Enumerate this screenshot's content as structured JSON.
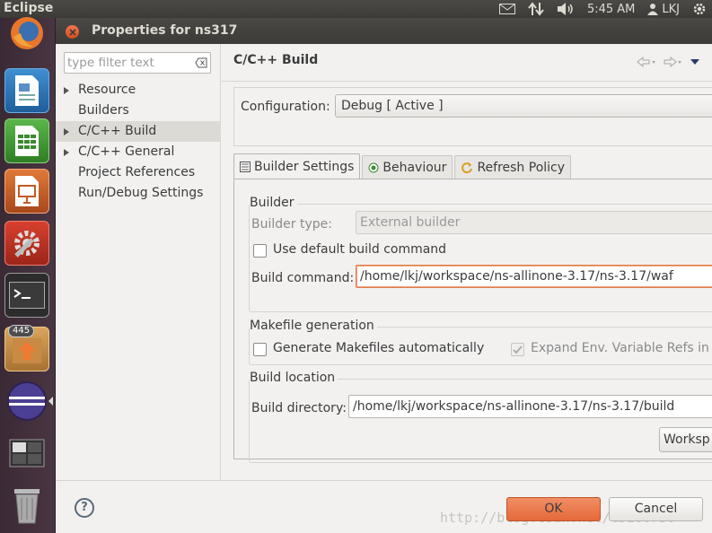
{
  "top_panel": {
    "app_name": "Eclipse",
    "time": "5:45 AM",
    "user": "LKJ",
    "icons": [
      "mail-icon",
      "network-icon",
      "volume-icon",
      "user-icon",
      "settings-icon"
    ]
  },
  "launcher": {
    "items": [
      "firefox-icon",
      "writer-icon",
      "calc-icon",
      "impress-icon",
      "system-settings-icon",
      "terminal-icon",
      "update-manager-icon",
      "eclipse-icon",
      "workspace-switcher-icon",
      "trash-icon"
    ],
    "update_badge": "445"
  },
  "dialog": {
    "title": "Properties for ns317",
    "filter_placeholder": "type filter text",
    "tree": [
      {
        "label": "Resource",
        "expandable": true,
        "selected": false
      },
      {
        "label": "Builders",
        "expandable": false,
        "selected": false
      },
      {
        "label": "C/C++ Build",
        "expandable": true,
        "selected": true
      },
      {
        "label": "C/C++ General",
        "expandable": true,
        "selected": false
      },
      {
        "label": "Project References",
        "expandable": false,
        "selected": false
      },
      {
        "label": "Run/Debug Settings",
        "expandable": false,
        "selected": false
      }
    ],
    "page_title": "C/C++ Build",
    "configuration": {
      "label": "Configuration:",
      "value": "Debug  [ Active ]"
    },
    "tabs": [
      {
        "label": "Builder Settings",
        "active": true,
        "icon": "settings-list-icon"
      },
      {
        "label": "Behaviour",
        "active": false,
        "icon": "radio-icon"
      },
      {
        "label": "Refresh Policy",
        "active": false,
        "icon": "refresh-icon"
      }
    ],
    "builder": {
      "group_title": "Builder",
      "type_label": "Builder type:",
      "type_value": "External builder",
      "use_default_label": "Use default build command",
      "use_default_checked": false,
      "command_label": "Build command:",
      "command_value": "/home/lkj/workspace/ns-allinone-3.17/ns-3.17/waf"
    },
    "makefile": {
      "group_title": "Makefile generation",
      "generate_label": "Generate Makefiles automatically",
      "generate_checked": false,
      "expand_env_label": "Expand Env. Variable Refs in M",
      "expand_env_checked": true
    },
    "location": {
      "group_title": "Build location",
      "dir_label": "Build directory:",
      "dir_value": "/home/lkj/workspace/ns-allinone-3.17/ns-3.17/build",
      "workspace_button": "Worksp"
    },
    "buttons": {
      "ok": "OK",
      "cancel": "Cancel"
    },
    "watermark": "http://blog.csdn.net/l3160730"
  }
}
